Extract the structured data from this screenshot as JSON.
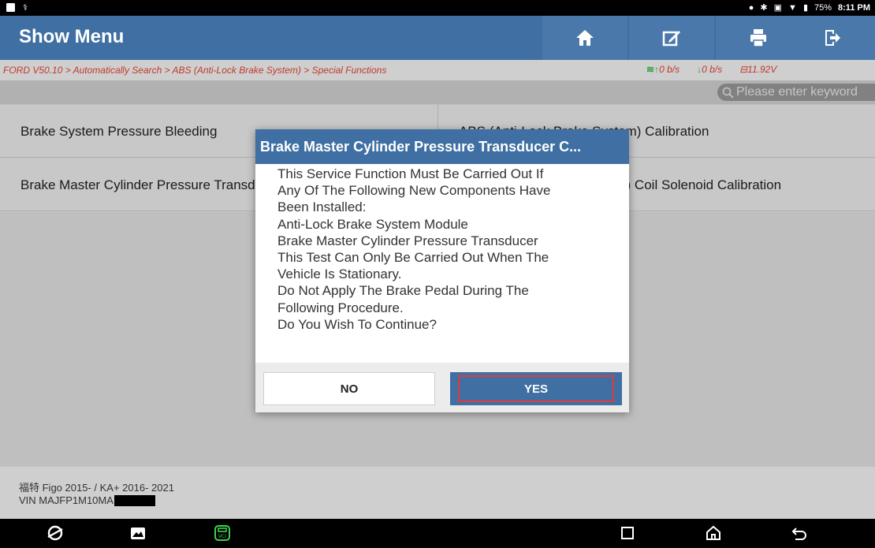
{
  "status_bar": {
    "battery": "75%",
    "time": "8:11 PM"
  },
  "header": {
    "title": "Show Menu",
    "icons": [
      "home-icon",
      "edit-icon",
      "print-icon",
      "exit-icon"
    ]
  },
  "breadcrumb": "FORD V50.10 > Automatically Search > ABS (Anti-Lock Brake System) > Special Functions",
  "network": {
    "upload": "0 b/s",
    "download": "0 b/s",
    "voltage": "11.92V"
  },
  "search": {
    "placeholder": "Please enter keyword"
  },
  "menu_items": [
    "Brake System Pressure Bleeding",
    "ABS (Anti-Lock Brake System) Calibration",
    "Brake Master Cylinder Pressure Transducer Calibration",
    "HCU (Hydraulic Control Unit) Coil Solenoid Calibration"
  ],
  "footer": {
    "vehicle": "福特 Figo 2015- / KA+ 2016- 2021",
    "vin": "VIN MAJFP1M10MA"
  },
  "dialog": {
    "title": "Brake Master Cylinder Pressure Transducer C...",
    "lines": [
      "This Service Function Must Be Carried Out If",
      "Any Of The Following New Components Have",
      "Been Installed:",
      "Anti-Lock Brake System Module",
      "Brake Master Cylinder Pressure Transducer",
      "This Test Can Only Be Carried Out When The",
      "Vehicle Is Stationary.",
      "Do Not Apply The Brake Pedal During The",
      "Following Procedure.",
      "Do You Wish To Continue?"
    ],
    "no_label": "NO",
    "yes_label": "YES"
  },
  "colors": {
    "header": "#3f6fa3",
    "breadcrumb_text": "#c0392b",
    "highlight": "#e23b3b"
  }
}
